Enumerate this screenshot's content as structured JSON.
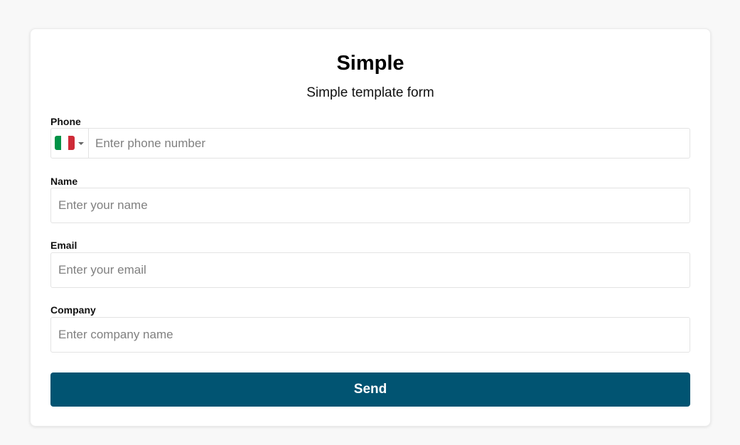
{
  "form": {
    "title": "Simple",
    "subtitle": "Simple template form",
    "phone": {
      "label": "Phone",
      "placeholder": "Enter phone number",
      "value": "",
      "country_flag": "italy-flag-icon",
      "flag_colors": [
        "#009246",
        "#ffffff",
        "#ce2b37"
      ]
    },
    "name": {
      "label": "Name",
      "placeholder": "Enter your name",
      "value": ""
    },
    "email": {
      "label": "Email",
      "placeholder": "Enter your email",
      "value": ""
    },
    "company": {
      "label": "Company",
      "placeholder": "Enter company name",
      "value": ""
    },
    "submit_label": "Send"
  },
  "colors": {
    "button": "#015472",
    "background": "#f8f8f8",
    "card": "#ffffff"
  }
}
